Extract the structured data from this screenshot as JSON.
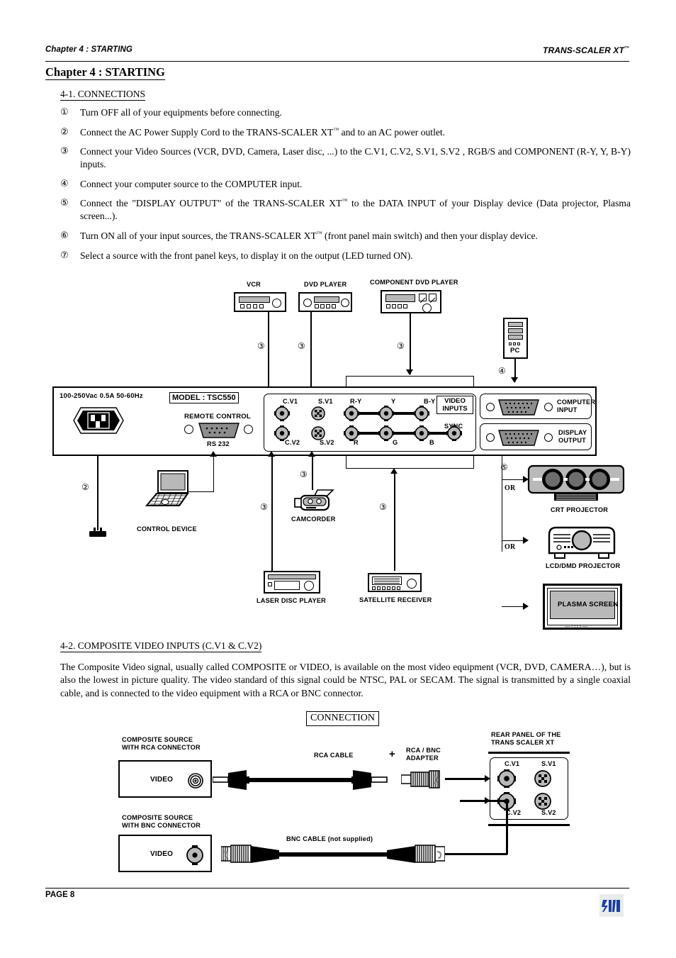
{
  "header": {
    "left": "Chapter 4 : STARTING",
    "right": "TRANS-SCALER XT",
    "right_tm": "™"
  },
  "chapter_title": "Chapter 4 : STARTING",
  "sections": {
    "connections": "4-1. CONNECTIONS",
    "composite": "4-2. COMPOSITE VIDEO INPUTS (C.V1 & C.V2)"
  },
  "steps": [
    {
      "num": "①",
      "text": "Turn OFF all of your equipments before connecting."
    },
    {
      "num": "②",
      "pre": "Connect the AC Power Supply Cord to the TRANS-SCALER XT",
      "tm": "™",
      "post": " and to an AC power outlet."
    },
    {
      "num": "③",
      "text": "Connect your Video Sources (VCR, DVD, Camera, Laser disc, ...) to the C.V1, C.V2, S.V1, S.V2 , RGB/S and COMPONENT (R-Y, Y, B-Y) inputs."
    },
    {
      "num": "④",
      "text": "Connect your computer source to the COMPUTER input."
    },
    {
      "num": "⑤",
      "pre": "Connect the \"DISPLAY OUTPUT\" of the TRANS-SCALER XT",
      "tm": "™",
      "post": " to the DATA INPUT of your Display device (Data projector, Plasma screen...)."
    },
    {
      "num": "⑥",
      "pre": "Turn ON all of your input sources, the TRANS-SCALER XT",
      "tm": "™",
      "post": " (front panel main switch) and then your display device."
    },
    {
      "num": "⑦",
      "text": "Select a source with the front panel keys, to display it on the output (LED turned ON)."
    }
  ],
  "composite_paragraph": "The Composite Video signal, usually called COMPOSITE or VIDEO, is available on the most video equipment (VCR, DVD, CAMERA…), but is also the lowest in picture quality. The video standard of this signal could be NTSC, PAL or SECAM. The signal is transmitted by a single coaxial cable, and is connected to the video equipment with a RCA or BNC connector.",
  "diagram_top": {
    "sources": [
      {
        "name": "vcr",
        "label": "VCR",
        "callout": "③"
      },
      {
        "name": "dvd-player",
        "label": "DVD PLAYER",
        "callout": "③"
      },
      {
        "name": "component-dvd-player",
        "label": "COMPONENT DVD PLAYER",
        "callout": "③"
      }
    ],
    "pc": {
      "label": "PC",
      "callout": "④"
    }
  },
  "rear_panel": {
    "power_rating": "100-250Vac 0.5A 50-60Hz",
    "model": "MODEL : TSC550",
    "remote_control": "REMOTE CONTROL",
    "rs232": "RS 232",
    "video_inputs": "VIDEO INPUTS",
    "video_inputs_line1": "VIDEO",
    "video_inputs_line2": "INPUTS",
    "sync": "SYNC",
    "jacks": {
      "cv1": "C.V1",
      "cv2": "C.V2",
      "sv1": "S.V1",
      "sv2": "S.V2",
      "ry": "R-Y",
      "y": "Y",
      "by": "B-Y",
      "r": "R",
      "g": "G",
      "b": "B"
    },
    "computer_input_l1": "COMPUTER",
    "computer_input_l2": "INPUT",
    "display_output_l1": "DISPLAY",
    "display_output_l2": "OUTPUT"
  },
  "diagram_bottom_sources": {
    "power_callout": "②",
    "control_device": "CONTROL DEVICE",
    "camcorder": "CAMCORDER",
    "camcorder_callout": "③",
    "laser_disc_player": "LASER DISC PLAYER",
    "laser_callout": "③",
    "satellite_receiver": "SATELLITE RECEIVER",
    "satellite_callout": "③"
  },
  "displays": {
    "callout": "⑤",
    "or": "OR",
    "crt": "CRT PROJECTOR",
    "lcd": "LCD/DMD PROJECTOR",
    "plasma": "PLASMA SCREEN"
  },
  "connection_diagram": {
    "title": "CONNECTION",
    "rca_source_l1": "COMPOSITE SOURCE",
    "rca_source_l2": "WITH RCA CONNECTOR",
    "bnc_source_l1": "COMPOSITE SOURCE",
    "bnc_source_l2": "WITH BNC CONNECTOR",
    "video": "VIDEO",
    "rca_cable": "RCA CABLE",
    "plus": "+",
    "adapter_l1": "RCA / BNC",
    "adapter_l2": "ADAPTER",
    "bnc_cable": "BNC CABLE (not supplied)",
    "rear_panel_l1": "REAR PANEL OF THE",
    "rear_panel_l2": "TRANS SCALER XT",
    "jacks": {
      "cv1": "C.V1",
      "sv1": "S.V1",
      "cv2": "C.V2",
      "sv2": "S.V2"
    }
  },
  "footer": {
    "page": "PAGE 8"
  },
  "colors": {
    "grey_fill": "#b9b9b9",
    "logo_blue": "#1c3f9e",
    "logo_bg": "#e9ecec"
  }
}
